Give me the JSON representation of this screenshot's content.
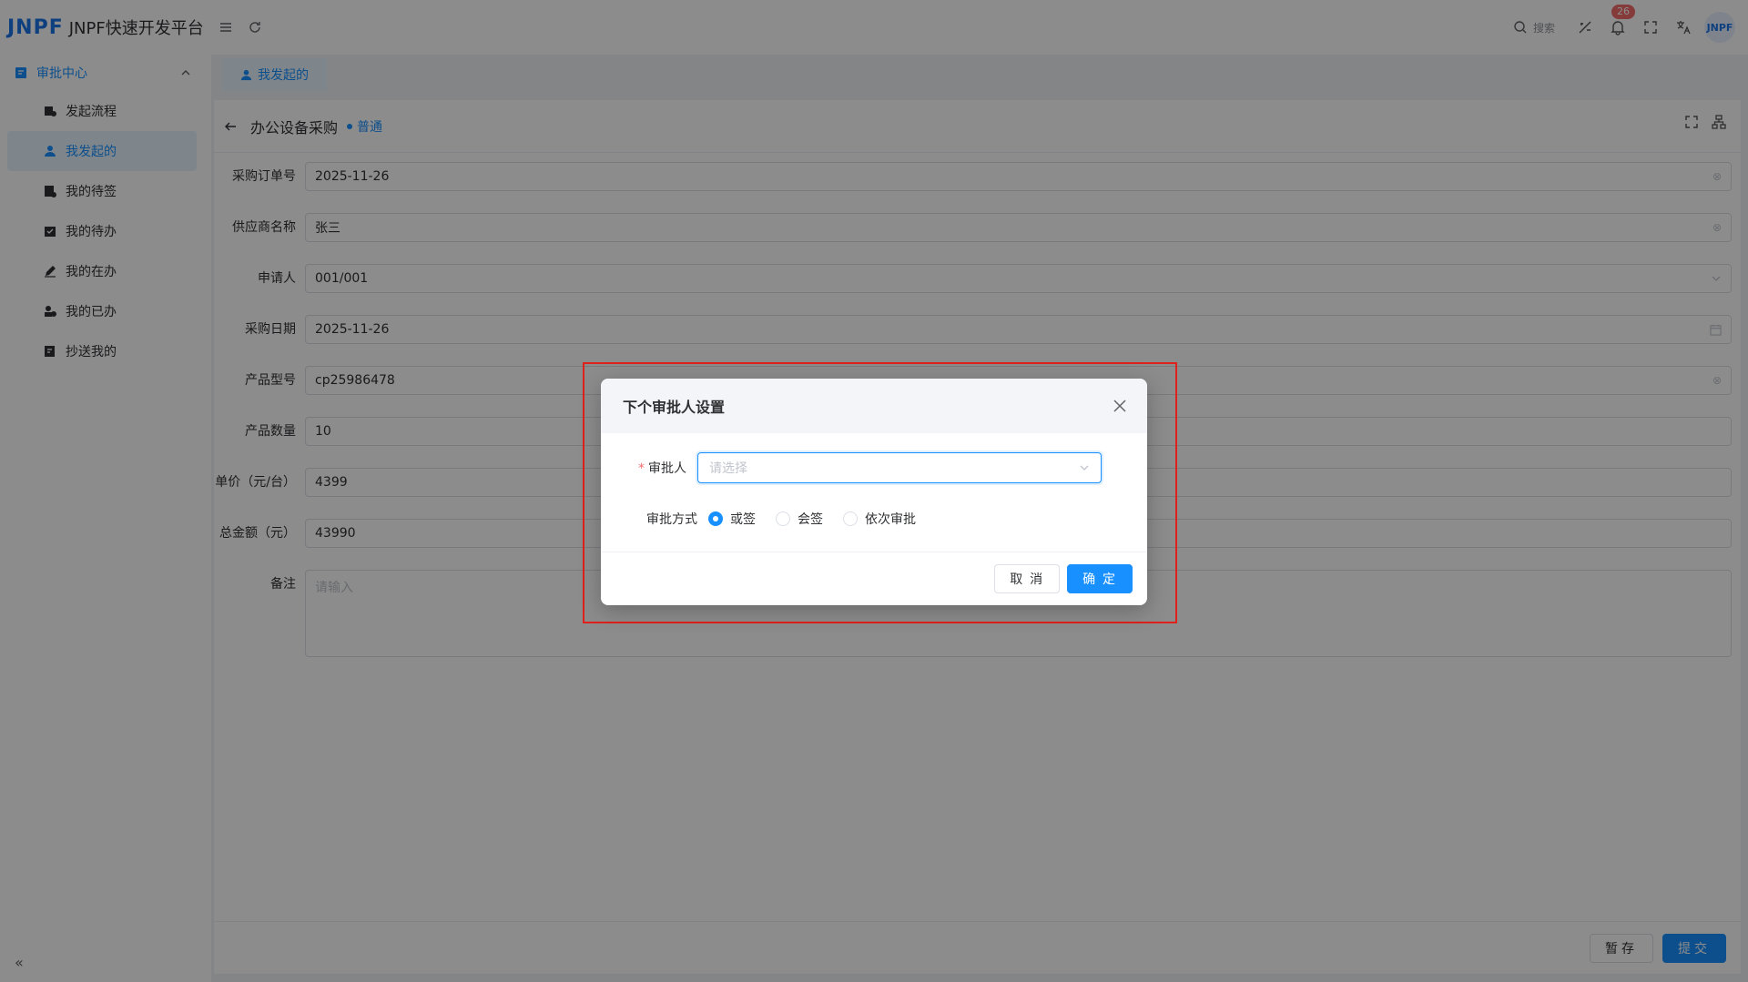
{
  "app": {
    "logo_mark": "JNPF",
    "title": "JNPF快速开发平台"
  },
  "header": {
    "search_label": "搜索",
    "notification_count": "26",
    "avatar_text": "JNPF"
  },
  "sidebar": {
    "group_label": "审批中心",
    "items": [
      {
        "label": "发起流程"
      },
      {
        "label": "我发起的"
      },
      {
        "label": "我的待签"
      },
      {
        "label": "我的待办"
      },
      {
        "label": "我的在办"
      },
      {
        "label": "我的已办"
      },
      {
        "label": "抄送我的"
      }
    ],
    "active_index": 1
  },
  "tabs": [
    {
      "label": "我发起的"
    }
  ],
  "page": {
    "title": "办公设备采购",
    "urgency": "普通"
  },
  "form": {
    "fields": [
      {
        "label": "采购订单号",
        "value": "2025-11-26"
      },
      {
        "label": "供应商名称",
        "value": "张三"
      },
      {
        "label": "申请人",
        "value": "001/001"
      },
      {
        "label": "采购日期",
        "value": "2025-11-26"
      },
      {
        "label": "产品型号",
        "value": "cp25986478"
      },
      {
        "label": "产品数量",
        "value": "10"
      },
      {
        "label": "单价（元/台）",
        "value": "4399"
      },
      {
        "label": "总金额（元）",
        "value": "43990"
      }
    ],
    "remark_label": "备注",
    "remark_placeholder": "请输入"
  },
  "footer": {
    "save_label": "暂存",
    "submit_label": "提交"
  },
  "dialog": {
    "title": "下个审批人设置",
    "approver_label": "审批人",
    "approver_placeholder": "请选择",
    "method_label": "审批方式",
    "methods": [
      {
        "label": "或签",
        "selected": true
      },
      {
        "label": "会签",
        "selected": false
      },
      {
        "label": "依次审批",
        "selected": false
      }
    ],
    "cancel_label": "取 消",
    "confirm_label": "确 定"
  },
  "colors": {
    "primary": "#1890ff",
    "highlight": "#e0201a",
    "badge": "#f56c6c"
  }
}
